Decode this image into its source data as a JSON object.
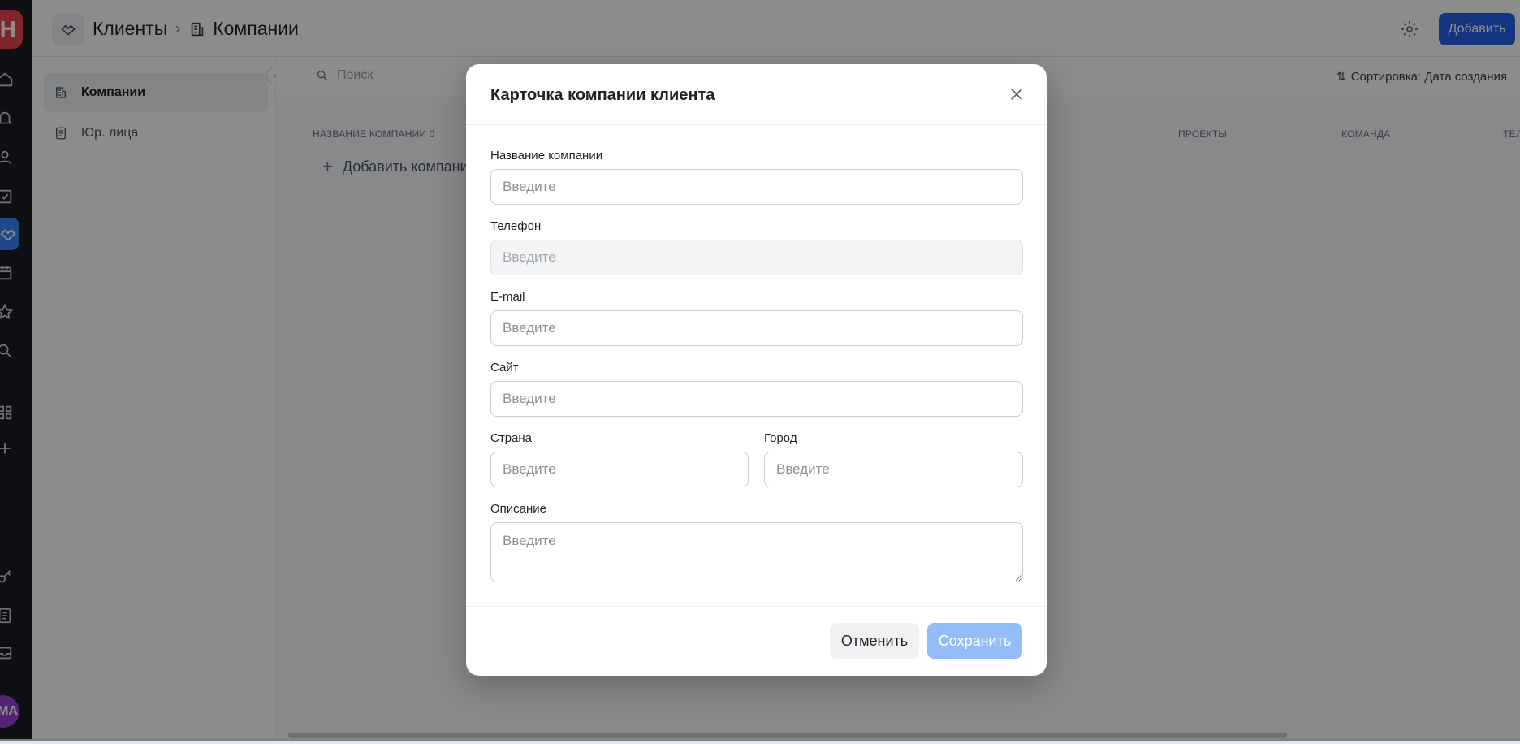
{
  "rail": {
    "logo_letter": "H",
    "avatar_initials": "МА",
    "items": [
      "home-icon",
      "bell-icon",
      "users-icon",
      "checklist-icon",
      "handshake-icon",
      "calendar-icon",
      "star-icon",
      "search-icon",
      "apps-icon",
      "plus-icon",
      "key-icon",
      "document-icon",
      "inbox-icon"
    ],
    "active_item": "handshake-icon",
    "active_color": "#3b82f6"
  },
  "header": {
    "crumb_1": "Клиенты",
    "crumb_separator": "›",
    "crumb_2": "Компании",
    "add_button": "Добавить",
    "accent_color": "#2563eb"
  },
  "sidebar": {
    "items": [
      {
        "label": "Компании",
        "icon": "building-icon",
        "active": true
      },
      {
        "label": "Юр. лица",
        "icon": "legal-doc-icon",
        "active": false
      }
    ]
  },
  "toolbar": {
    "search_placeholder": "Поиск",
    "sort_label": "Сортировка: Дата создания"
  },
  "table": {
    "columns": [
      "НАЗВАНИЕ КОМПАНИИ 0",
      "ПРОЕКТЫ",
      "КОМАНДА",
      "ТЕЛ"
    ],
    "add_row_label": "Добавить компанию"
  },
  "modal": {
    "title": "Карточка компании клиента",
    "fields": {
      "company_name": {
        "label": "Название компании",
        "placeholder": "Введите",
        "value": ""
      },
      "phone": {
        "label": "Телефон",
        "placeholder": "Введите",
        "value": "",
        "disabled": true
      },
      "email": {
        "label": "E-mail",
        "placeholder": "Введите",
        "value": ""
      },
      "site": {
        "label": "Сайт",
        "placeholder": "Введите",
        "value": ""
      },
      "country": {
        "label": "Страна",
        "placeholder": "Введите",
        "value": ""
      },
      "city": {
        "label": "Город",
        "placeholder": "Введите",
        "value": ""
      },
      "description": {
        "label": "Описание",
        "placeholder": "Введите",
        "value": ""
      }
    },
    "cancel_button": "Отменить",
    "save_button": "Сохранить",
    "save_button_color": "#93bdf8"
  }
}
